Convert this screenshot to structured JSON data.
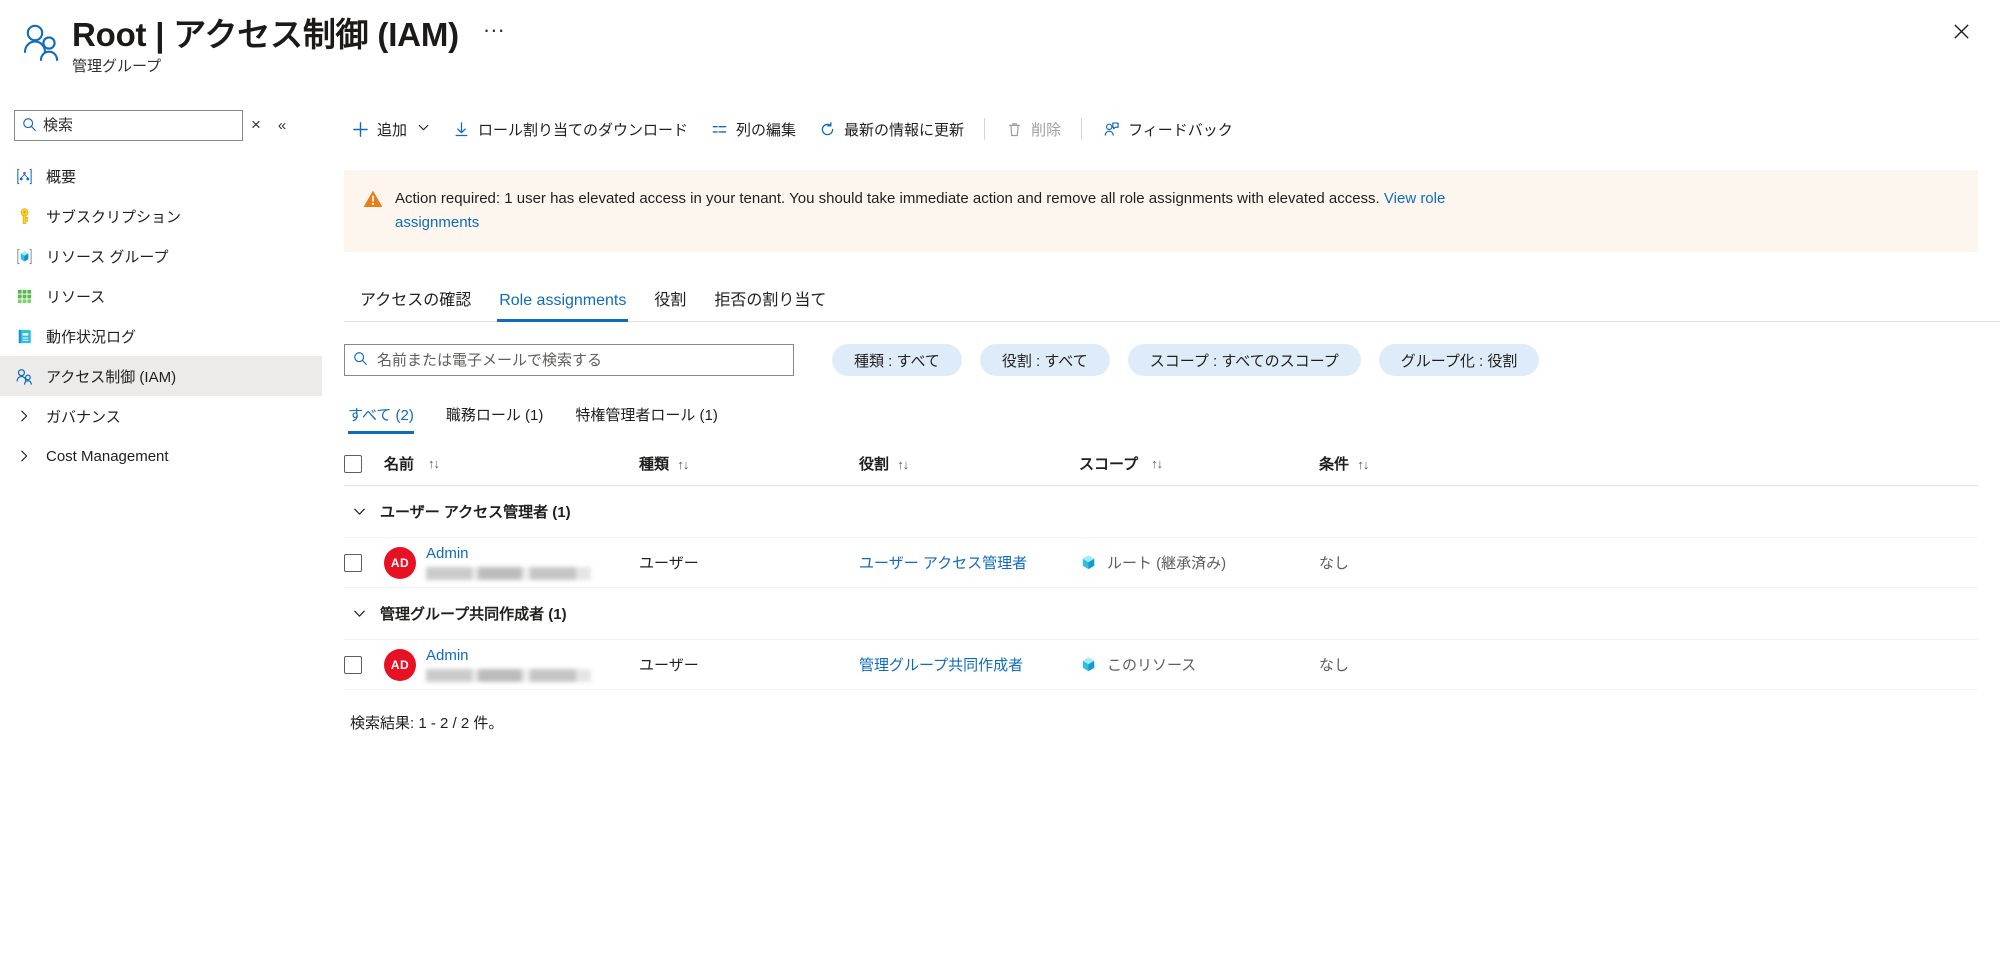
{
  "header": {
    "icon": "users-group-icon",
    "title": "Root | アクセス制御 (IAM)",
    "subtitle": "管理グループ",
    "more_label": "···",
    "close_label": "✕"
  },
  "sidebar": {
    "search": {
      "placeholder": "検索",
      "value": "",
      "icon": "search-icon"
    },
    "clear_label": "×",
    "collapse_label": "«",
    "items": [
      {
        "label": "概要",
        "icon": "overview-icon",
        "selected": false,
        "expandable": false
      },
      {
        "label": "サブスクリプション",
        "icon": "key-icon",
        "selected": false,
        "expandable": false
      },
      {
        "label": "リソース グループ",
        "icon": "resource-group-icon",
        "selected": false,
        "expandable": false
      },
      {
        "label": "リソース",
        "icon": "resources-grid-icon",
        "selected": false,
        "expandable": false
      },
      {
        "label": "動作状況ログ",
        "icon": "activity-log-icon",
        "selected": false,
        "expandable": false
      },
      {
        "label": "アクセス制御 (IAM)",
        "icon": "access-control-icon",
        "selected": true,
        "expandable": false
      },
      {
        "label": "ガバナンス",
        "icon": "chevron-right-icon",
        "selected": false,
        "expandable": true
      },
      {
        "label": "Cost Management",
        "icon": "chevron-right-icon",
        "selected": false,
        "expandable": true
      }
    ]
  },
  "commandbar": {
    "items": [
      {
        "label": "追加",
        "icon": "plus-icon",
        "caret": true,
        "disabled": false
      },
      {
        "label": "ロール割り当てのダウンロード",
        "icon": "download-icon",
        "caret": false,
        "disabled": false
      },
      {
        "label": "列の編集",
        "icon": "edit-columns-icon",
        "caret": false,
        "disabled": false
      },
      {
        "label": "最新の情報に更新",
        "icon": "refresh-icon",
        "caret": false,
        "disabled": false
      },
      {
        "label": "削除",
        "icon": "trash-icon",
        "caret": false,
        "disabled": true
      },
      {
        "label": "フィードバック",
        "icon": "feedback-icon",
        "caret": false,
        "disabled": false
      }
    ]
  },
  "banner": {
    "icon": "warning-triangle-icon",
    "text": "Action required: 1 user has elevated access in your tenant. You should take immediate action and remove all role assignments with elevated access. ",
    "link_text": "View role assignments",
    "background": "#fdf6ef",
    "icon_color": "#e8801a"
  },
  "tabs": [
    {
      "label": "アクセスの確認",
      "active": false
    },
    {
      "label": "Role assignments",
      "active": true
    },
    {
      "label": "役割",
      "active": false
    },
    {
      "label": "拒否の割り当て",
      "active": false
    }
  ],
  "filters": {
    "search": {
      "placeholder": "名前または電子メールで検索する",
      "value": "",
      "icon": "search-icon"
    },
    "pills": [
      {
        "label": "種類 : すべて"
      },
      {
        "label": "役割 : すべて"
      },
      {
        "label": "スコープ : すべてのスコープ"
      },
      {
        "label": "グループ化 : 役割"
      }
    ]
  },
  "subtabs": [
    {
      "label": "すべて (2)",
      "active": true
    },
    {
      "label": "職務ロール (1)",
      "active": false
    },
    {
      "label": "特権管理者ロール (1)",
      "active": false
    }
  ],
  "table": {
    "columns": [
      {
        "label": "名前",
        "sortable": true
      },
      {
        "label": "種類",
        "sortable": true
      },
      {
        "label": "役割",
        "sortable": true
      },
      {
        "label": "スコープ",
        "sortable": true
      },
      {
        "label": "条件",
        "sortable": true
      }
    ],
    "sort_glyph": "↑↓",
    "groups": [
      {
        "label": "ユーザー アクセス管理者 (1)",
        "expanded": true,
        "chevron": "chevron-down-icon",
        "rows": [
          {
            "avatar_initials": "AD",
            "avatar_color": "#e81123",
            "name": "Admin",
            "email_redacted": true,
            "type": "ユーザー",
            "role": "ユーザー アクセス管理者",
            "scope": "ルート (継承済み)",
            "scope_icon": "resource-cube-icon",
            "condition": "なし"
          }
        ]
      },
      {
        "label": "管理グループ共同作成者 (1)",
        "expanded": true,
        "chevron": "chevron-down-icon",
        "rows": [
          {
            "avatar_initials": "AD",
            "avatar_color": "#e81123",
            "name": "Admin",
            "email_redacted": true,
            "type": "ユーザー",
            "role": "管理グループ共同作成者",
            "scope": "このリソース",
            "scope_icon": "resource-cube-icon",
            "condition": "なし"
          }
        ]
      }
    ]
  },
  "footer": {
    "result_text": "検索結果: 1 - 2 / 2 件。"
  },
  "colors": {
    "accent": "#0f6cbd",
    "selected_bg": "#edebe9",
    "pill_bg": "#deecf9",
    "warning_bg": "#fdf6ef",
    "warning_icon": "#e8801a",
    "avatar_red": "#e81123",
    "muted_text": "#605e5c"
  }
}
